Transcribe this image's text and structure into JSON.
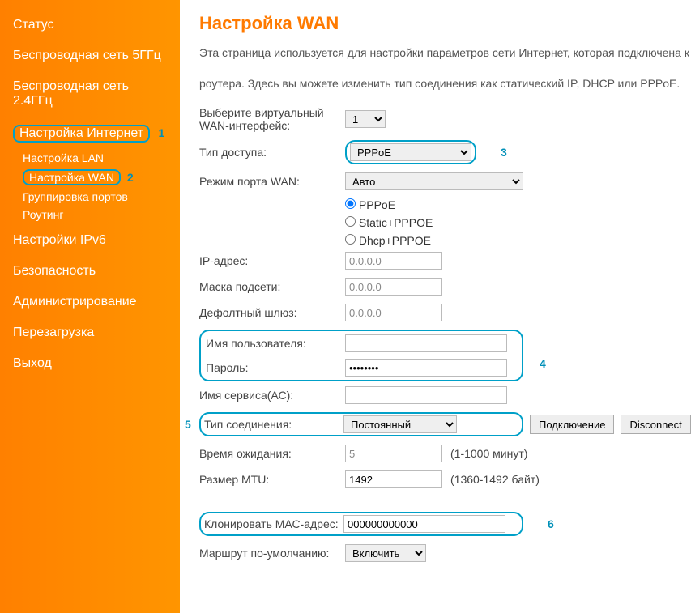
{
  "sidebar": {
    "items": [
      "Статус",
      "Беспроводная сеть 5ГГц",
      "Беспроводная сеть 2.4ГГц",
      "Настройка Интернет",
      "Настройки IPv6",
      "Безопасность",
      "Администрирование",
      "Перезагрузка",
      "Выход"
    ],
    "sub_items": [
      "Настройка LAN",
      "Настройка WAN",
      "Группировка портов",
      "Роутинг"
    ]
  },
  "page": {
    "title": "Настройка WAN",
    "intro1": "Эта страница используется для настройки параметров сети Интернет, которая подключена к WAN-порту вашего",
    "intro2": "роутера. Здесь вы можете изменить тип соединения как статический IP, DHCP или PPPoE."
  },
  "labels": {
    "virtual_wan": "Выберите виртуальный WAN-интерфейс:",
    "access_type": "Тип доступа:",
    "wan_port_mode": "Режим порта WAN:",
    "ip": "IP-адрес:",
    "mask": "Маска подсети:",
    "gateway": "Дефолтный шлюз:",
    "username": "Имя пользователя:",
    "password": "Пароль:",
    "service_name": "Имя сервиса(АС):",
    "conn_type": "Тип соединения:",
    "idle_time": "Время ожидания:",
    "mtu": "Размер MTU:",
    "clone_mac": "Клонировать МАС-адрес:",
    "default_route": "Маршрут по-умолчанию:"
  },
  "values": {
    "virtual_wan": "1",
    "access_type": "PPPoE",
    "wan_port_mode": "Авто",
    "radio_pppoe": "PPPoE",
    "radio_static": "Static+PPPOE",
    "radio_dhcp": "Dhcp+PPPOE",
    "ip": "0.0.0.0",
    "mask": "0.0.0.0",
    "gateway": "0.0.0.0",
    "username": "",
    "password": "••••••••",
    "service_name": "",
    "conn_type": "Постоянный",
    "idle_time": "5",
    "idle_hint": "(1-1000 минут)",
    "mtu": "1492",
    "mtu_hint": "(1360-1492 байт)",
    "clone_mac": "000000000000",
    "default_route": "Включить"
  },
  "buttons": {
    "connect": "Подключение",
    "disconnect": "Disconnect"
  },
  "annotations": {
    "a1": "1",
    "a2": "2",
    "a3": "3",
    "a4": "4",
    "a5": "5",
    "a6": "6"
  }
}
